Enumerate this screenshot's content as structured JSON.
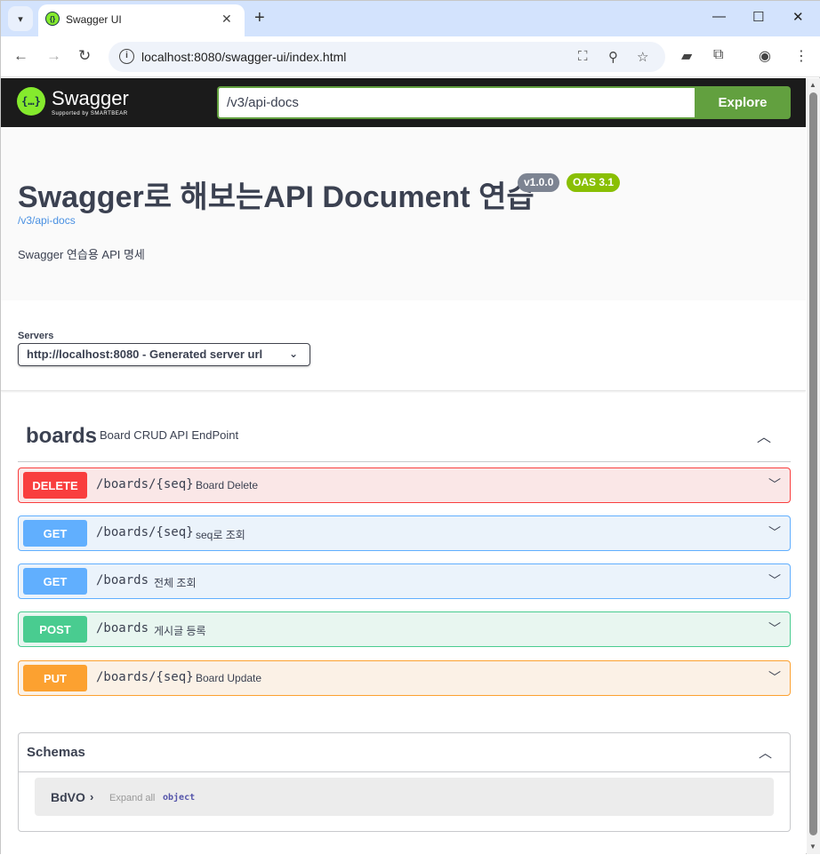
{
  "browser": {
    "tab_title": "Swagger UI",
    "tab_close": "✕",
    "new_tab": "+",
    "url": "localhost:8080/swagger-ui/index.html",
    "minimize": "—",
    "maximize": "☐",
    "close": "✕"
  },
  "topbar": {
    "logo_word": "Swagger",
    "logo_sub": "Supported by SMARTBEAR",
    "api_url": "/v3/api-docs",
    "explore_label": "Explore"
  },
  "info": {
    "title": "Swagger로 해보는API Document 연습",
    "version": "v1.0.0",
    "oas": "OAS 3.1",
    "link": "/v3/api-docs",
    "description": "Swagger 연습용 API 명세"
  },
  "servers": {
    "label": "Servers",
    "selected": "http://localhost:8080 - Generated server url"
  },
  "tag": {
    "name": "boards",
    "description": "Board CRUD API EndPoint"
  },
  "operations": [
    {
      "method": "DELETE",
      "path": "/boards/{seq}",
      "summary": "Board Delete"
    },
    {
      "method": "GET",
      "path": "/boards/{seq}",
      "summary": "seq로 조회"
    },
    {
      "method": "GET",
      "path": "/boards",
      "summary": "전체 조회"
    },
    {
      "method": "POST",
      "path": "/boards",
      "summary": "게시글 등록"
    },
    {
      "method": "PUT",
      "path": "/boards/{seq}",
      "summary": "Board Update"
    }
  ],
  "schemas": {
    "title": "Schemas",
    "model_name": "BdVO",
    "expand_label": "Expand all",
    "model_type": "object"
  },
  "colors": {
    "delete": "#f93e3e",
    "get": "#61affe",
    "post": "#49cc90",
    "put": "#fca130",
    "explore": "#62a03f"
  }
}
